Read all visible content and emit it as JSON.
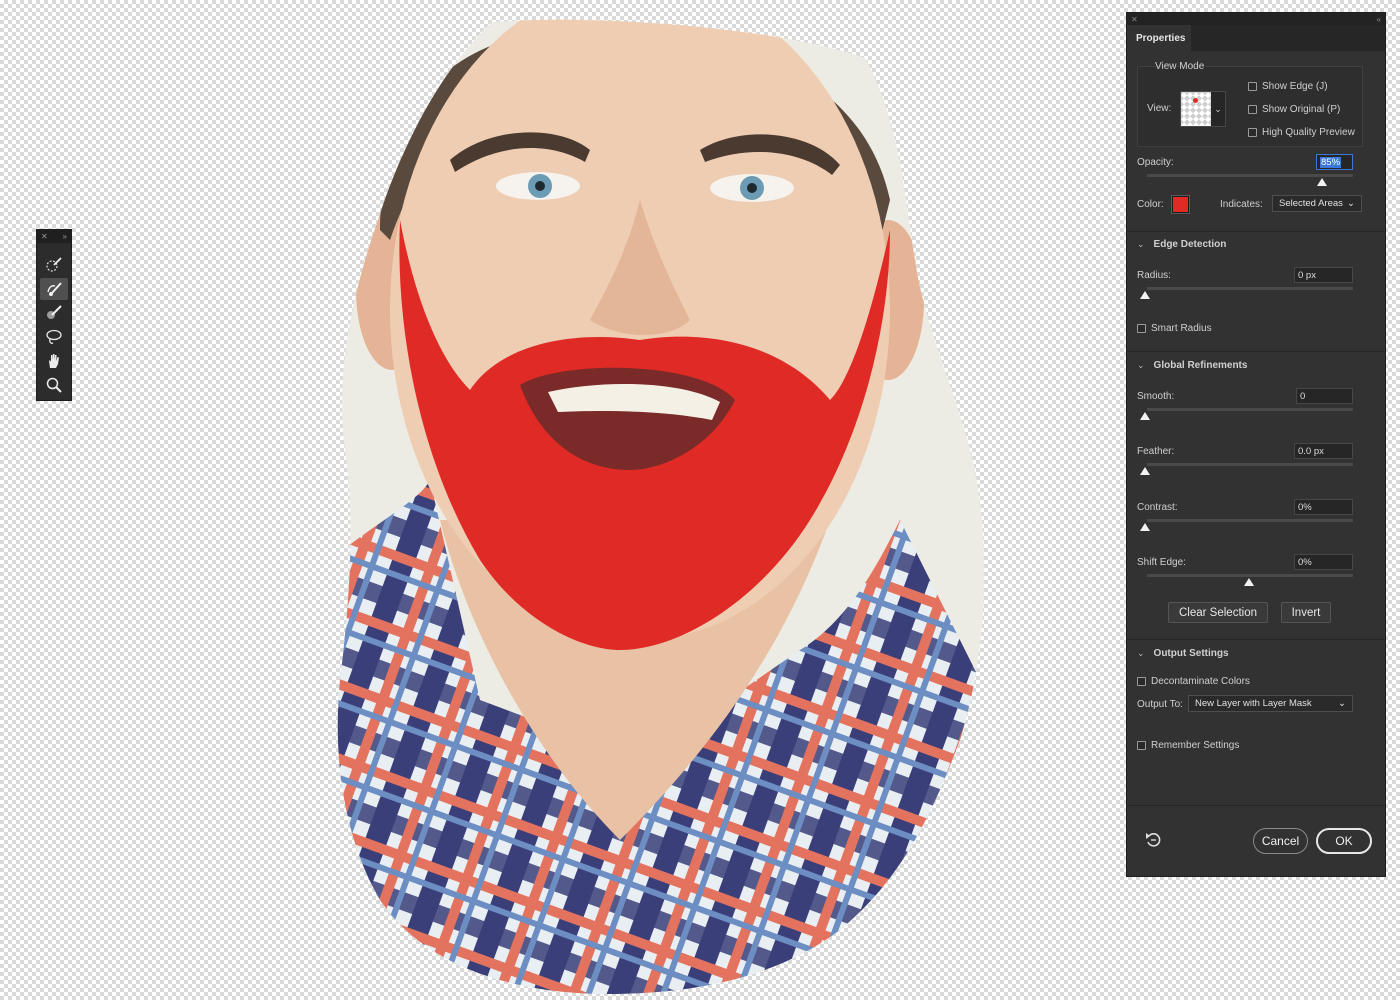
{
  "tools_panel": {
    "tools": [
      {
        "icon": "quick-selection-tool-icon",
        "active": false
      },
      {
        "icon": "refine-edge-brush-tool-icon",
        "active": true
      },
      {
        "icon": "brush-tool-icon",
        "active": false
      },
      {
        "icon": "lasso-tool-icon",
        "active": false
      },
      {
        "icon": "hand-tool-icon",
        "active": false
      },
      {
        "icon": "zoom-tool-icon",
        "active": false
      }
    ]
  },
  "properties": {
    "tab_label": "Properties",
    "view_mode": {
      "title": "View Mode",
      "view_label": "View:",
      "show_edge": "Show Edge (J)",
      "show_original": "Show Original (P)",
      "high_quality": "High Quality Preview"
    },
    "opacity": {
      "label": "Opacity:",
      "value": "85%",
      "fraction": 0.85
    },
    "color": {
      "label": "Color:",
      "swatch": "#e02a26"
    },
    "indicates": {
      "label": "Indicates:",
      "value": "Selected Areas"
    },
    "edge_detection": {
      "title": "Edge Detection",
      "radius_label": "Radius:",
      "radius_value": "0 px",
      "smart_radius": "Smart Radius"
    },
    "global_refinements": {
      "title": "Global Refinements",
      "smooth_label": "Smooth:",
      "smooth_value": "0",
      "feather_label": "Feather:",
      "feather_value": "0.0 px",
      "contrast_label": "Contrast:",
      "contrast_value": "0%",
      "shift_label": "Shift Edge:",
      "shift_value": "0%",
      "clear_selection": "Clear Selection",
      "invert": "Invert"
    },
    "output_settings": {
      "title": "Output Settings",
      "decontaminate": "Decontaminate Colors",
      "output_label": "Output To:",
      "output_value": "New Layer with Layer Mask",
      "remember": "Remember Settings"
    },
    "cancel": "Cancel",
    "ok": "OK"
  },
  "colors": {
    "panel_bg": "#323232",
    "overlay_red": "#e02a26",
    "highlight_blue": "#3b78d8"
  }
}
